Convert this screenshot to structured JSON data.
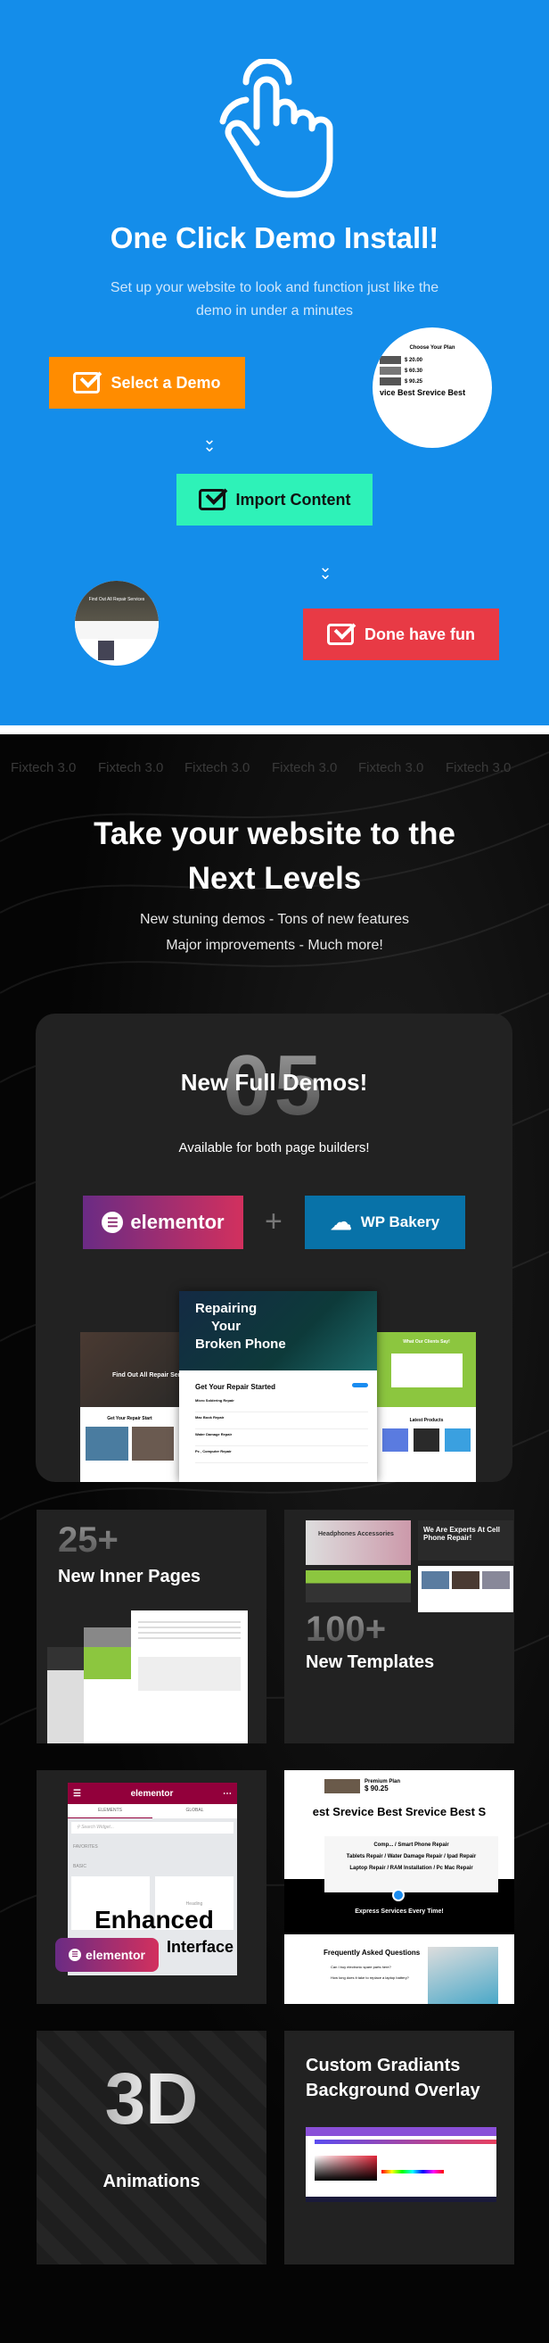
{
  "intro": {
    "title": "One Click Demo Install!",
    "subtitle_line1": "Set up your website to look and function just like the",
    "subtitle_line2": "demo in under a minutes",
    "steps": [
      {
        "label": "Select a Demo",
        "color": "#FF8C00",
        "text_color": "#FFFFFF"
      },
      {
        "label": "Import Content",
        "color": "#2EF2B8",
        "text_color": "#111111"
      },
      {
        "label": "Done have fun",
        "color": "#E83A45",
        "text_color": "#FFFFFF"
      }
    ],
    "preview_plan": {
      "heading": "Choose Your Plan",
      "prices": [
        "$ 20.00",
        "$ 60.30",
        "$ 90.25"
      ],
      "marquee": "vice  Best Srevice  Best"
    },
    "preview_hero": "Find Out All Repair Services"
  },
  "marquee": {
    "text": "Fixtech 3.0"
  },
  "headline": {
    "line1": "Take your website to the",
    "line2": "Next Levels",
    "sub1": "New stuning demos - Tons of new features",
    "sub2": "Major improvements - Much more!"
  },
  "demos": {
    "number": "05",
    "title": "New Full Demos!",
    "subtitle": "Available for both page builders!",
    "elementor_label": "elementor",
    "plus": "+",
    "wpbakery_label": "WP Bakery",
    "hero_title": [
      "Repairing",
      "Your",
      "Broken Phone"
    ],
    "section_title": "Get Your Repair Started",
    "services": [
      "Micro Soldering Repair",
      "Mac Book Repair",
      "Water Damage Repair",
      "Pc , Computer Repair"
    ],
    "left_hero": "Find Out All Repair Servic",
    "left_section": "Get Your Repair Start",
    "right_heading": "What Our Clients Say!",
    "right_products": "Latest Products"
  },
  "features": {
    "inner": {
      "number": "25+",
      "label": "New Inner Pages"
    },
    "templates": {
      "number": "100+",
      "label": "New Templates",
      "banner": "Headphones Accessories",
      "experts": "We Are Experts At Cell Phone Repair!"
    },
    "interface": {
      "panel_title": "elementor",
      "tab1": "ELEMENTS",
      "tab2": "GLOBAL",
      "search_placeholder": "Search Widget...",
      "favorites": "FAVORITES",
      "basic": "BASIC",
      "heading_widget": "Heading",
      "word1": "Enhanced",
      "word2": "Interface",
      "badge": "elementor"
    },
    "services": {
      "plan": "Premium Plan",
      "price": "$ 90.25",
      "marquee": "est Srevice  Best Srevice  Best S",
      "row1": "Comp...  /  Smart Phone Repair",
      "row2": "Tablets Repair  /  Water Damage Repair  /  Ipad Repair",
      "row3": "Laptop Repair  /  RAM Installation  /  Pc Mac Repair",
      "express": "Express Services Every Time!",
      "faq": "Frequently Asked Questions",
      "q1": "Can I buy electronic spare parts here?",
      "q2": "How long does it take to replace a laptop battery?"
    },
    "animations": {
      "big": "3D",
      "label": "Animations"
    },
    "gradients": {
      "line1": "Custom Gradiants",
      "line2": "Background Overlay"
    }
  }
}
